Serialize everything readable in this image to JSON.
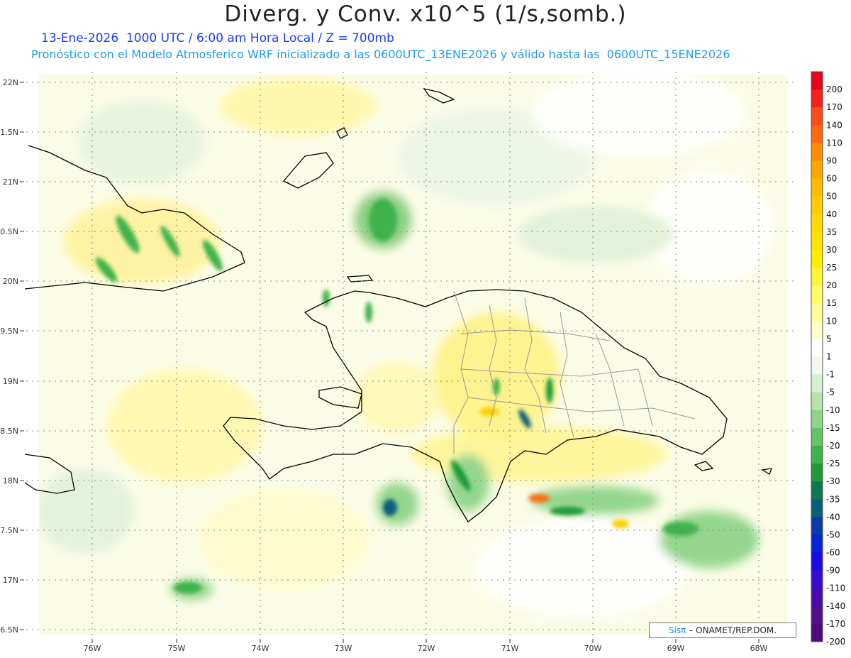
{
  "header": {
    "title": "Diverg. y Conv. x10^5 (1/s,somb.)",
    "subtitle_date": "13-Ene-2026  1000 UTC / 6:00 am Hora Local / Z = 700mb",
    "subtitle_model": "Pronóstico con el Modelo Atmosferico WRF inicializado a las 0600UTC_13ENE2026 y válido hasta las  0600UTC_15ENE2026"
  },
  "map": {
    "lat_labels": [
      "22N",
      "1.5N",
      "21N",
      "0.5N",
      "20N",
      "9.5N",
      "19N",
      "8.5N",
      "18N",
      "7.5N",
      "17N",
      "6.5N"
    ],
    "lon_labels": [
      "76W",
      "75W",
      "74W",
      "73W",
      "72W",
      "71W",
      "70W",
      "69W",
      "68W"
    ]
  },
  "colorbar": {
    "labels": [
      "200",
      "170",
      "140",
      "110",
      "90",
      "60",
      "50",
      "40",
      "35",
      "30",
      "25",
      "20",
      "15",
      "10",
      "5",
      "1",
      "-1",
      "-5",
      "-10",
      "-15",
      "-20",
      "-25",
      "-30",
      "-35",
      "-40",
      "-50",
      "-60",
      "-90",
      "-110",
      "-140",
      "-170",
      "-200"
    ],
    "colors": [
      "#e8001a",
      "#f4201e",
      "#ff4a1a",
      "#ff6a10",
      "#ff8c00",
      "#ffa500",
      "#ffbb00",
      "#ffcc00",
      "#ffd800",
      "#ffe400",
      "#ffee00",
      "#fff533",
      "#fffa66",
      "#fffc99",
      "#fffdc8",
      "#ffffff",
      "#f0f8ee",
      "#d6efcf",
      "#b6e2ac",
      "#8fd488",
      "#66c467",
      "#3fb24b",
      "#1f9a36",
      "#0f7a52",
      "#0a5f7a",
      "#0a3ca8",
      "#0a22d8",
      "#1a0ae8",
      "#3a0ad0",
      "#4a0ab0",
      "#50108f",
      "#500a78"
    ]
  },
  "credit": {
    "logo": "Sisπ",
    "text": "– ONAMET/REP.DOM."
  }
}
